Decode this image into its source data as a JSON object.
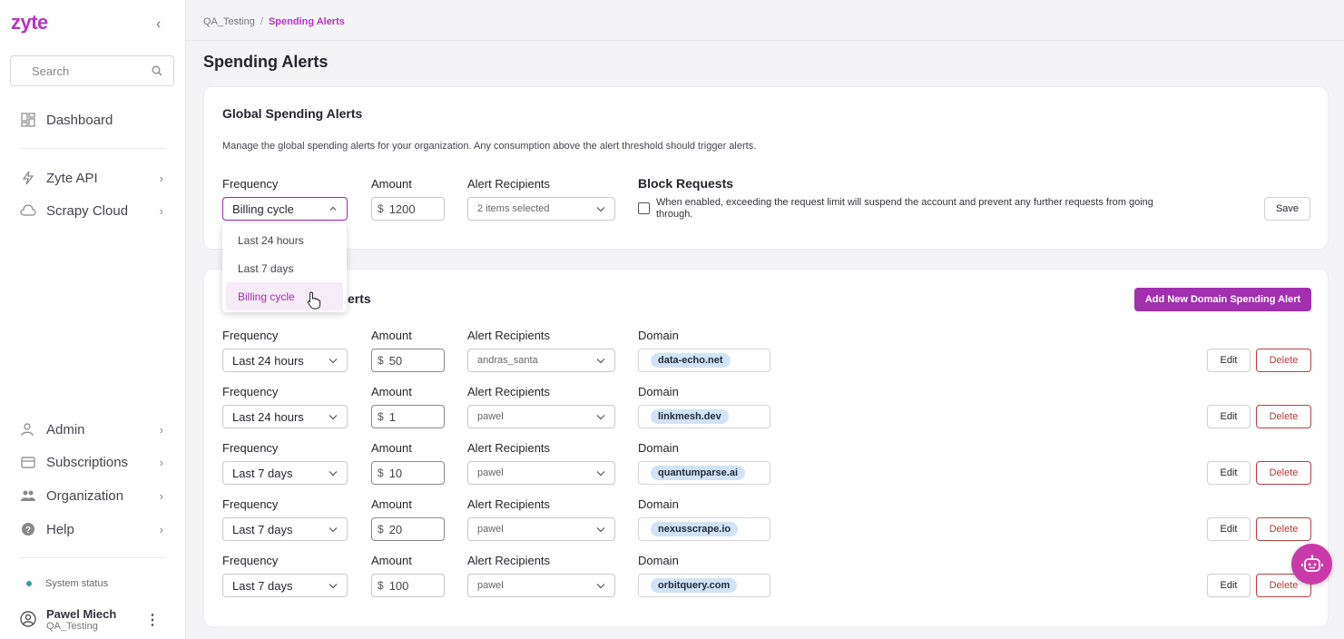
{
  "app": {
    "logo": "zyte"
  },
  "sidebar": {
    "search_placeholder": "Search",
    "items": [
      {
        "label": "Dashboard",
        "icon": "dashboard-icon"
      },
      {
        "label": "Zyte API",
        "icon": "bolt-icon"
      },
      {
        "label": "Scrapy Cloud",
        "icon": "cloud-icon"
      },
      {
        "label": "Admin",
        "icon": "admin-icon"
      },
      {
        "label": "Subscriptions",
        "icon": "card-icon"
      },
      {
        "label": "Organization",
        "icon": "people-icon"
      },
      {
        "label": "Help",
        "icon": "help-icon"
      }
    ],
    "status": "System status",
    "user": {
      "name": "Pawel Miech",
      "org": "QA_Testing"
    }
  },
  "breadcrumb": {
    "parent": "QA_Testing",
    "separator": "/",
    "current": "Spending Alerts"
  },
  "page": {
    "title": "Spending Alerts"
  },
  "global": {
    "title": "Global Spending Alerts",
    "description": "Manage the global spending alerts for your organization. Any consumption above the alert threshold should trigger alerts.",
    "frequency_label": "Frequency",
    "frequency_value": "Billing cycle",
    "amount_label": "Amount",
    "currency": "$",
    "amount_value": "1200",
    "recipients_label": "Alert Recipients",
    "recipients_value": "2 items selected",
    "block_label": "Block Requests",
    "block_text_1": "When enabled, exceeding the request limit will suspend the account and prevent any further requests from going",
    "block_text_2": "through.",
    "save_label": "Save"
  },
  "dropdown": {
    "options": [
      "Last 24 hours",
      "Last 7 days",
      "Billing cycle"
    ],
    "selected": "Billing cycle"
  },
  "domain": {
    "title_visible": "erts",
    "add_button": "Add New Domain Spending Alert",
    "labels": {
      "frequency": "Frequency",
      "amount": "Amount",
      "recipients": "Alert Recipients",
      "domain": "Domain"
    },
    "edit_label": "Edit",
    "delete_label": "Delete",
    "rows": [
      {
        "frequency": "Last 24 hours",
        "amount": "50",
        "recipients": "andras_santa",
        "domain": "data-echo.net"
      },
      {
        "frequency": "Last 24 hours",
        "amount": "1",
        "recipients": "pawel",
        "domain": "linkmesh.dev"
      },
      {
        "frequency": "Last 7 days",
        "amount": "10",
        "recipients": "pawel",
        "domain": "quantumparse.ai"
      },
      {
        "frequency": "Last 7 days",
        "amount": "20",
        "recipients": "pawel",
        "domain": "nexusscrape.io"
      },
      {
        "frequency": "Last 7 days",
        "amount": "100",
        "recipients": "pawel",
        "domain": "orbitquery.com"
      }
    ]
  },
  "colors": {
    "brand": "#b833c3",
    "primary_button": "#a12fb0",
    "delete": "#b23a3a",
    "chip": "#d2e3f7",
    "status_dot": "#2aa39a"
  }
}
